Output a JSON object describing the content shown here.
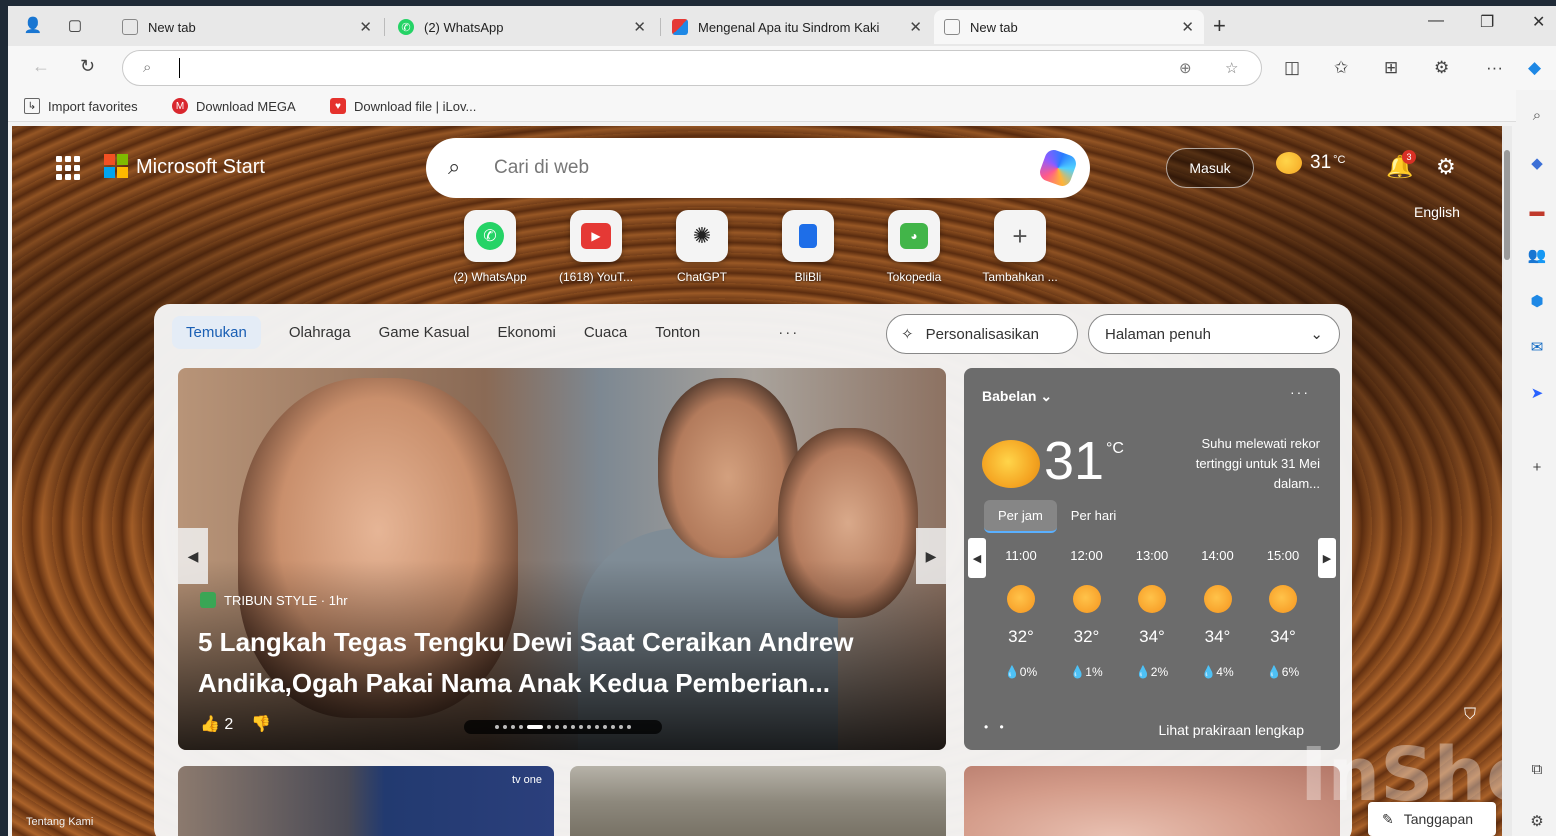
{
  "browser": {
    "tabs": [
      {
        "title": "New tab",
        "icon": "page-icon",
        "active": false
      },
      {
        "title": "(2) WhatsApp",
        "icon": "whatsapp-icon",
        "active": false
      },
      {
        "title": "Mengenal Apa itu Sindrom Kaki",
        "icon": "site-icon",
        "active": false
      },
      {
        "title": "New tab",
        "icon": "page-icon",
        "active": true
      }
    ],
    "address_value": "",
    "bookmarks": [
      {
        "label": "Import favorites",
        "icon": "import-icon"
      },
      {
        "label": "Download   MEGA",
        "icon": "mega-icon"
      },
      {
        "label": "Download file | iLov...",
        "icon": "ilovepdf-icon"
      }
    ]
  },
  "page": {
    "brand": "Microsoft Start",
    "search_placeholder": "Cari di web",
    "sign_in": "Masuk",
    "temperature": "31",
    "temp_unit": "°C",
    "notification_count": "3",
    "language": "English",
    "shortcuts": [
      {
        "label": "(2) WhatsApp",
        "icon": "whatsapp-icon",
        "color": "#25d366"
      },
      {
        "label": "(1618) YouT...",
        "icon": "youtube-icon",
        "color": "#e53935"
      },
      {
        "label": "ChatGPT",
        "icon": "chatgpt-icon",
        "color": "#222222"
      },
      {
        "label": "BliBli",
        "icon": "blibli-icon",
        "color": "#1e6ee8"
      },
      {
        "label": "Tokopedia",
        "icon": "tokopedia-icon",
        "color": "#42b549"
      },
      {
        "label": "Tambahkan ...",
        "icon": "plus-icon",
        "color": "#555555"
      }
    ],
    "feed_tabs": [
      "Temukan",
      "Olahraga",
      "Game Kasual",
      "Ekonomi",
      "Cuaca",
      "Tonton"
    ],
    "more": "···",
    "personalize": "Personalisasikan",
    "layout_select": "Halaman penuh",
    "hero": {
      "source": "TRIBUN STYLE · 1hr",
      "headline": "5 Langkah Tegas Tengku Dewi Saat Ceraikan Andrew Andika,Ogah Pakai Nama Anak Kedua Pemberian...",
      "likes": "2"
    },
    "weather": {
      "location": "Babelan",
      "temp": "31",
      "unit": "°C",
      "alert": "Suhu melewati rekor tertinggi untuk 31 Mei dalam...",
      "tab_hourly": "Per jam",
      "tab_daily": "Per hari",
      "hours": [
        {
          "time": "11:00",
          "temp": "32°",
          "precip": "0%"
        },
        {
          "time": "12:00",
          "temp": "32°",
          "precip": "1%"
        },
        {
          "time": "13:00",
          "temp": "34°",
          "precip": "2%"
        },
        {
          "time": "14:00",
          "temp": "34°",
          "precip": "4%"
        },
        {
          "time": "15:00",
          "temp": "34°",
          "precip": "6%"
        }
      ],
      "full_forecast": "Lihat prakiraan lengkap"
    },
    "card1_badge": "tv one",
    "about": "Tentang Kami",
    "feedback": "Tanggapan",
    "watermark": "InShot"
  }
}
